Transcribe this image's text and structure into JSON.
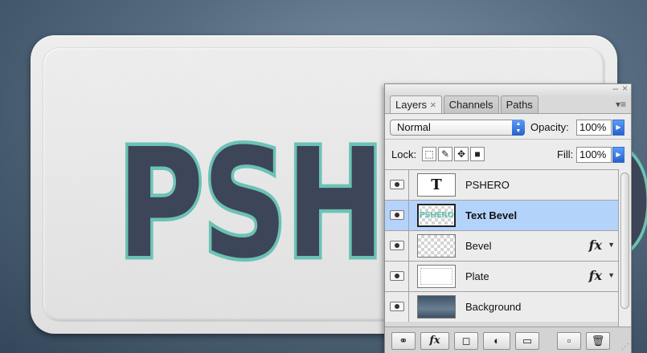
{
  "canvas": {
    "plate_text": "PSHERO",
    "colors": {
      "background": "#566b80",
      "plate": "#e8e8e8",
      "text_fill": "#3d4558",
      "text_stroke": "#6cc2b4"
    }
  },
  "panel": {
    "window_buttons": {
      "minimize": "–",
      "close": "×"
    },
    "tabs": [
      {
        "label": "Layers",
        "close": "×",
        "active": true
      },
      {
        "label": "Channels",
        "active": false
      },
      {
        "label": "Paths",
        "active": false
      }
    ],
    "blend_mode": "Normal",
    "opacity_label": "Opacity:",
    "opacity_value": "100%",
    "lock_label": "Lock:",
    "fill_label": "Fill:",
    "fill_value": "100%",
    "layers": [
      {
        "name": "PSHERO",
        "thumbnail": "text-layer-icon",
        "thumb_text": "T",
        "selected": false,
        "fx": false
      },
      {
        "name": "Text Bevel",
        "thumbnail": "pshero-mini",
        "thumb_text": "PSHERO",
        "selected": true,
        "fx": false
      },
      {
        "name": "Bevel",
        "thumbnail": "transparent-checker",
        "selected": false,
        "fx": true
      },
      {
        "name": "Plate",
        "thumbnail": "plate-outline",
        "selected": false,
        "fx": true
      },
      {
        "name": "Background",
        "thumbnail": "gradient-fill",
        "selected": false,
        "fx": false
      }
    ],
    "fx_label": "fx",
    "selection_color": "#b3d3fb",
    "bottom_buttons": [
      {
        "icon": "link-layers-icon",
        "glyph": "⚭"
      },
      {
        "icon": "fx-styles-icon",
        "glyph": "fx"
      },
      {
        "icon": "layer-mask-icon",
        "glyph": "◻"
      },
      {
        "icon": "adjustment-layer-icon",
        "glyph": "◐"
      },
      {
        "icon": "new-group-icon",
        "glyph": "▭"
      },
      {
        "icon": "new-layer-icon",
        "glyph": "▫"
      },
      {
        "icon": "trash-icon",
        "glyph": "🗑"
      }
    ]
  }
}
